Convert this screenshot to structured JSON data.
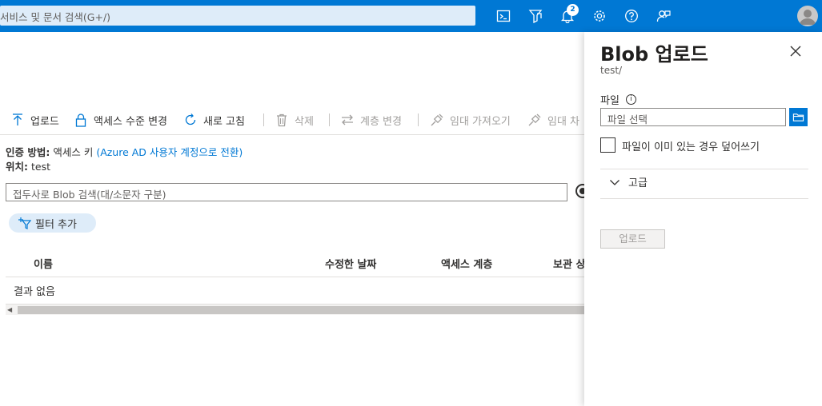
{
  "topbar": {
    "search_placeholder": "서비스 및 문서 검색(G+/)",
    "notification_count": "2",
    "icons": [
      "cloud-shell-icon",
      "directory-filter-icon",
      "bell-icon",
      "gear-icon",
      "help-icon",
      "feedback-icon",
      "avatar"
    ],
    "accent": "#0078d4"
  },
  "toolbar": {
    "upload": "업로드",
    "access_tier": "액세스 수준 변경",
    "refresh": "새로 고침",
    "delete": "삭제",
    "change_tier": "계층 변경",
    "acquire_lease": "임대 가져오기",
    "break_lease": "임대 차"
  },
  "info": {
    "auth_label": "인증 방법:",
    "auth_value": "액세스 키",
    "auth_link": "(Azure AD 사용자 계정으로 전환)",
    "location_label": "위치:",
    "location_value": "test"
  },
  "search": {
    "placeholder": "접두사로 Blob 검색(대/소문자 구분)"
  },
  "filter": {
    "label": "필터 추가"
  },
  "table": {
    "columns": [
      "이름",
      "수정한 날짜",
      "액세스 계층",
      "보관 상"
    ],
    "empty": "결과 없음"
  },
  "panel": {
    "title": "Blob 업로드",
    "subtitle": "test/",
    "file_label": "파일",
    "file_placeholder": "파일 선택",
    "overwrite_label": "파일이 이미 있는 경우 덮어쓰기",
    "advanced_label": "고급",
    "upload_button": "업로드"
  }
}
